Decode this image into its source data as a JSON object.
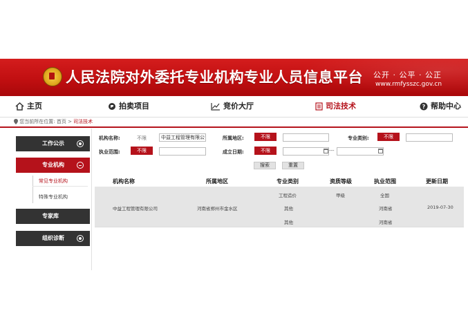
{
  "header": {
    "title": "人民法院对外委托专业机构专业人员信息平台",
    "slogan": "公开 · 公平 · 公正",
    "domain": "www.rmfysszc.gov.cn"
  },
  "nav": {
    "home": "主页",
    "auction": "拍卖项目",
    "bidding": "竞价大厅",
    "judicial": "司法技术",
    "help": "帮助中心"
  },
  "breadcrumb": {
    "prefix": "您当前所在位置:",
    "home": "首页",
    "sep": ">",
    "current": "司法技术"
  },
  "sidebar": {
    "work_notice": "工作公示",
    "institutions": "专业机构",
    "common_inst": "常见专业机构",
    "special_inst": "特殊专业机构",
    "experts": "专家库",
    "org_diag": "组织诊断"
  },
  "form": {
    "name_label": "机构名称:",
    "name_limit": "不限",
    "name_value": "中益工程管理有限公司",
    "region_label": "所属地区:",
    "region_limit": "不限",
    "region_value": "",
    "type_label": "专业类别:",
    "type_limit": "不限",
    "type_value": "",
    "scope_label": "执业范围:",
    "scope_limit": "不限",
    "scope_value": "",
    "date_label": "成立日期:",
    "date_limit": "不限",
    "date_from": "",
    "date_to": "",
    "date_sep": "---",
    "search": "搜索",
    "reset": "重置"
  },
  "table": {
    "headers": [
      "机构名称",
      "所属地区",
      "专业类别",
      "资质等级",
      "执业范围",
      "更新日期"
    ],
    "row": {
      "name": "中益工程管理有限公司",
      "region": "河南省郑州市金水区",
      "categories": [
        "工程造价",
        "其他",
        "其他"
      ],
      "grade": "甲级",
      "scopes": [
        "全国",
        "河南省",
        "河南省"
      ],
      "date": "2019-07-30"
    }
  },
  "colors": {
    "brand_red": "#b5121b",
    "sidebar_dark": "#333333",
    "row_bg": "#e5e5e5"
  }
}
